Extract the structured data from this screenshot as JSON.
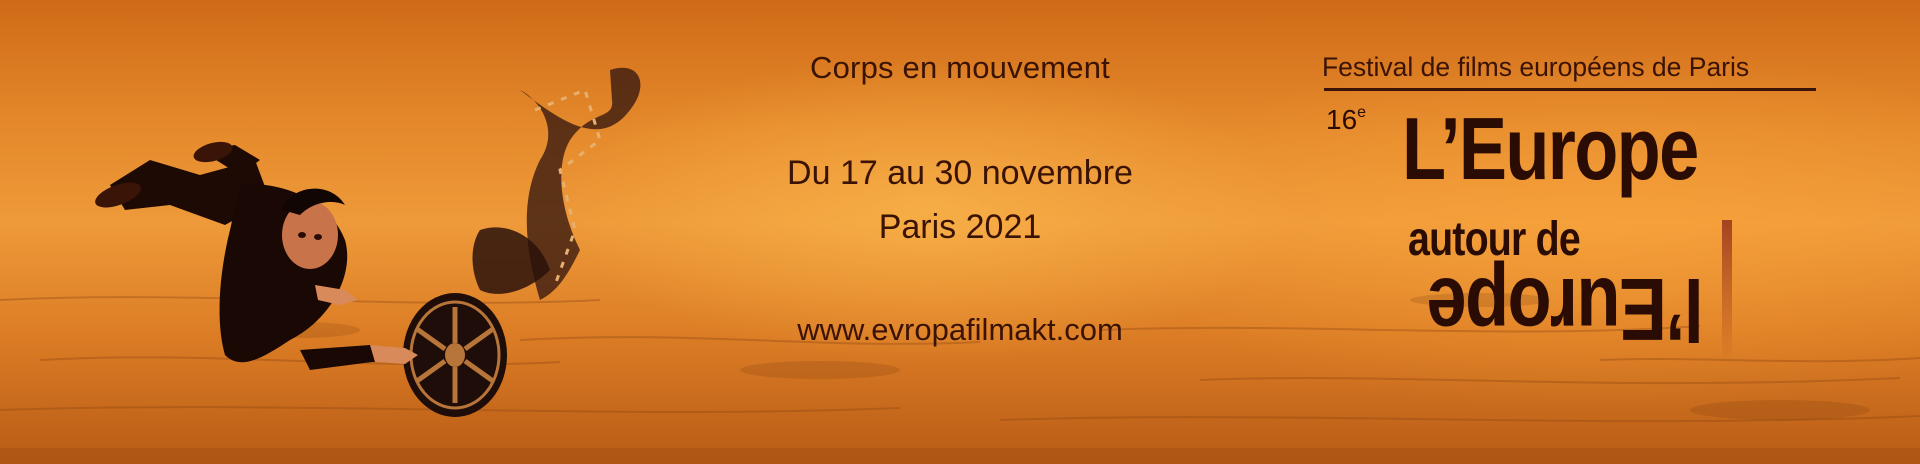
{
  "banner": {
    "tagline": "Corps en mouvement",
    "dates": "Du 17 au 30 novembre",
    "city": "Paris 2021",
    "website": "www.evropafilmakt.com"
  },
  "festival": {
    "name": "Festival de films européens de Paris",
    "edition_number": "16",
    "edition_suffix": "e",
    "logo_line1": "L’Europe",
    "logo_line2": "autour de",
    "logo_mirror_text": "l’Europe"
  },
  "colors": {
    "text": "#3a1305",
    "logo_dark": "#2a0c04",
    "logo_red": "#8a1510",
    "background": "#e58a2c"
  },
  "icons": {
    "illustration": "man-diving-with-film-reel"
  }
}
